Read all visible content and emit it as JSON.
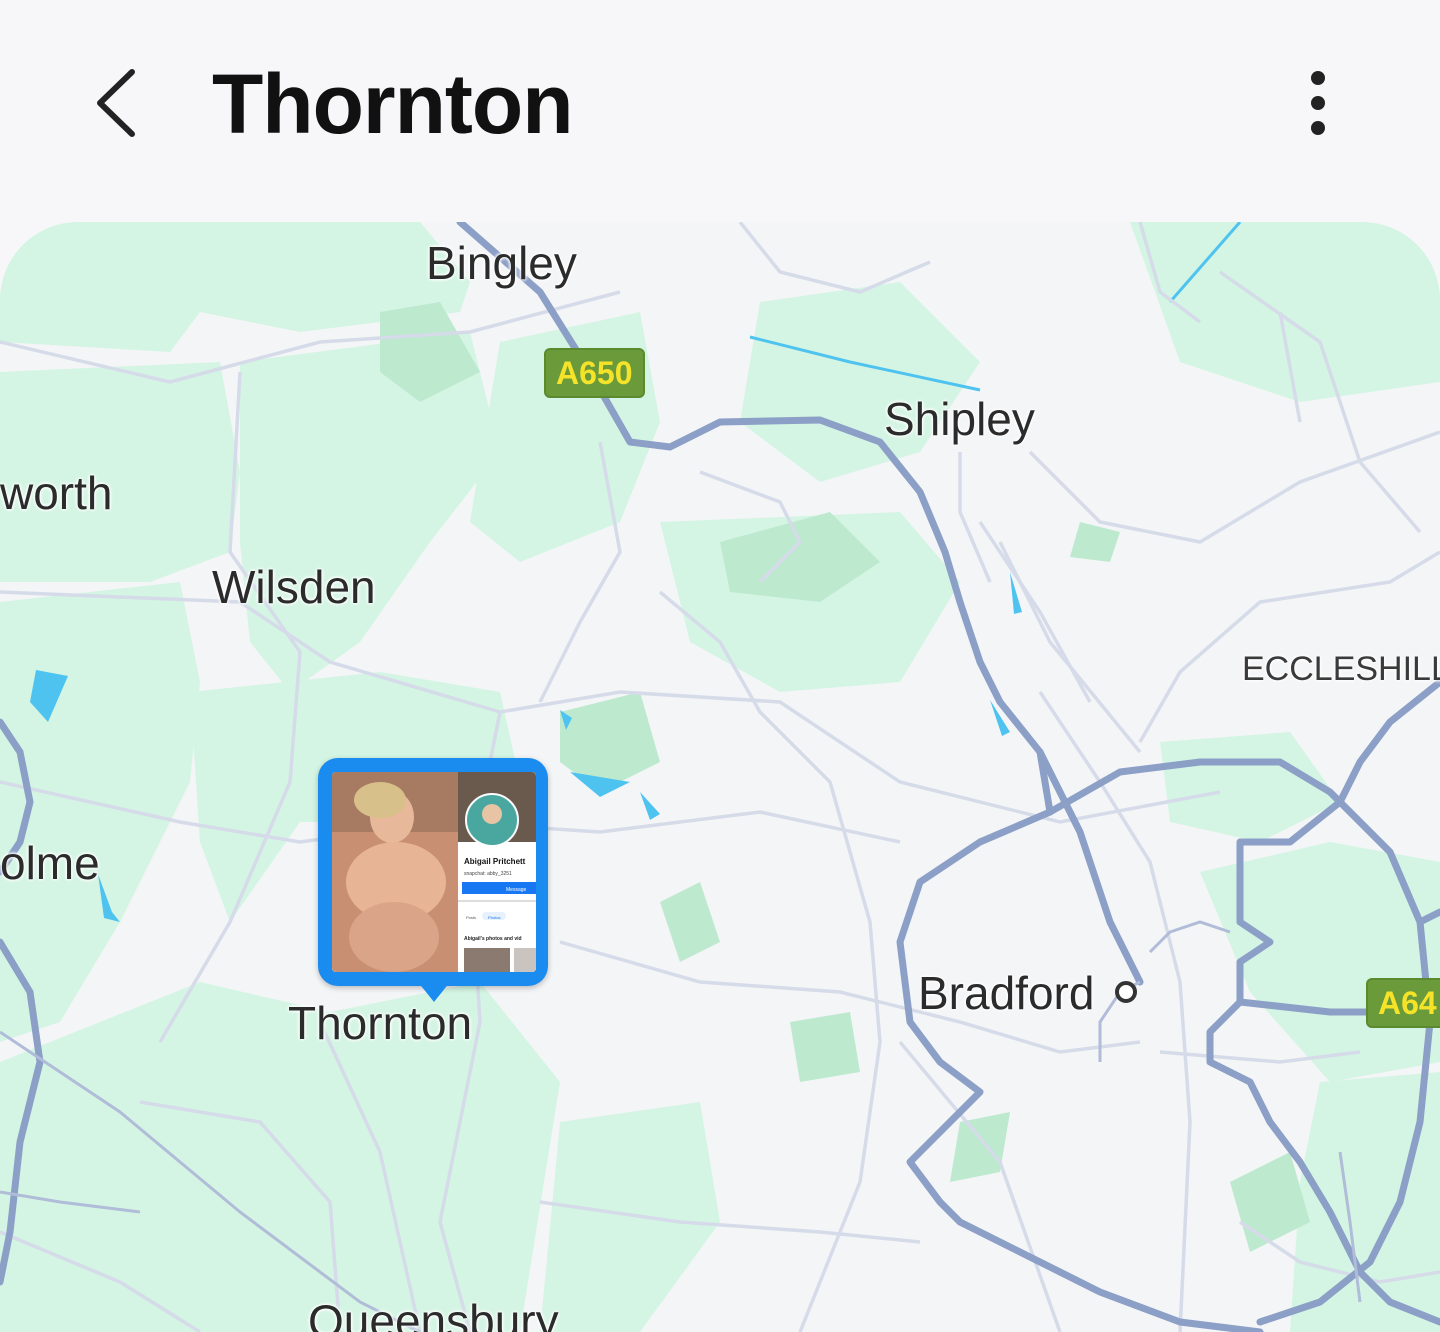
{
  "header": {
    "title": "Thornton",
    "back_icon": "chevron-left-icon",
    "more_icon": "more-vertical-icon"
  },
  "map": {
    "places": {
      "bingley": "Bingley",
      "shipley": "Shipley",
      "worth": "worth",
      "wilsden": "Wilsden",
      "eccleshill": "ECCLESHILL",
      "olme": "olme",
      "thornton": "Thornton",
      "bradford": "Bradford",
      "queensbury": "Queensbury"
    },
    "roads": {
      "a650": "A650",
      "a64": "A64"
    },
    "pin": {
      "photo_name": "Abigail Pritchett",
      "photo_sub": "snapchat: abby_3251",
      "photo_btn": "Message",
      "tab_posts": "Posts",
      "tab_photos": "Photos",
      "photo_section": "Abigail's photos and vid"
    },
    "colors": {
      "land": "#f4f5f7",
      "green": "#d4f5e4",
      "dark_green": "#bde9cf",
      "major_road": "#8c9fc7",
      "minor_road": "#d5dbe8",
      "water": "#4fc3f0",
      "pin": "#1a8cf0"
    }
  }
}
